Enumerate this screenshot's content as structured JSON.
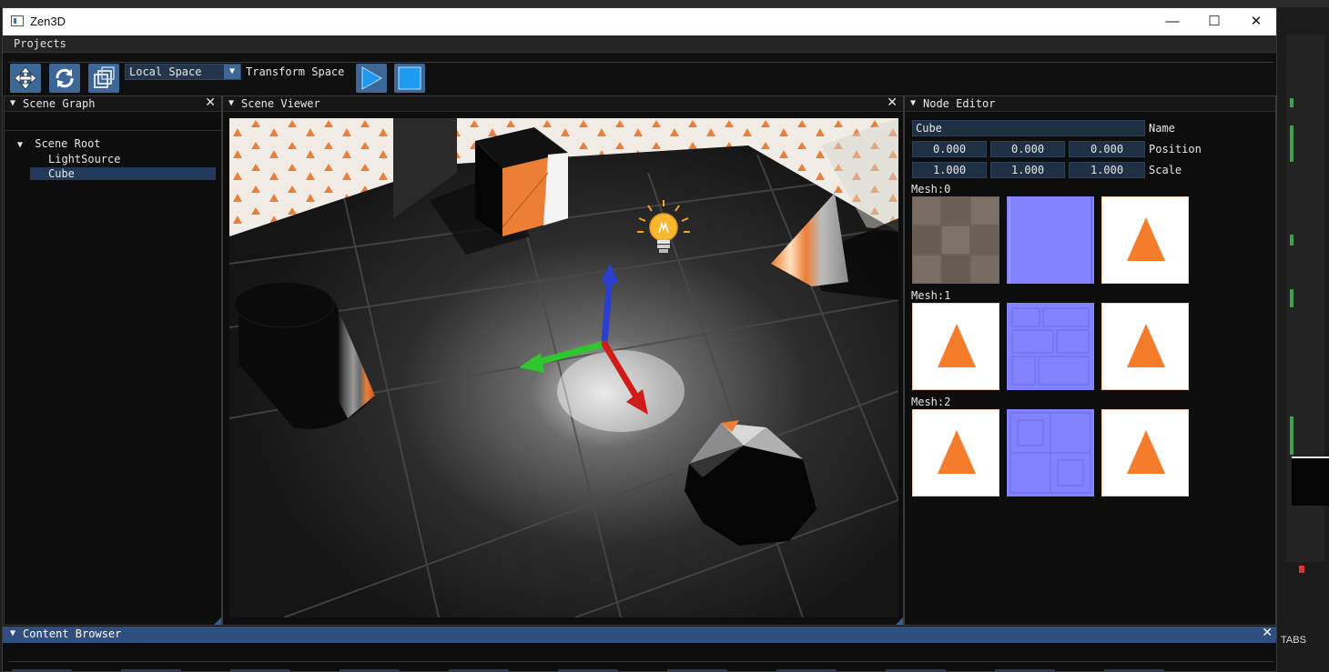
{
  "window": {
    "title": "Zen3D",
    "minimize_icon": "minimize-icon",
    "maximize_icon": "maximize-icon",
    "close_icon": "close-icon"
  },
  "menu": {
    "items": [
      "Projects"
    ]
  },
  "toolbar": {
    "buttons": [
      "move-tool-icon",
      "rotate-tool-icon",
      "scale-tool-icon"
    ],
    "space_select": {
      "value": "Local Space",
      "arrow": "▼"
    },
    "space_label": "Transform Space",
    "play_icon": "play-icon",
    "stop_icon": "stop-icon",
    "accent_color": "#3c6797"
  },
  "scene_graph": {
    "title": "Scene Graph",
    "collapse_glyph": "▼",
    "close_glyph": "✕",
    "root": {
      "label": "Scene Root",
      "glyph": "▼"
    },
    "children": [
      {
        "label": "LightSource",
        "selected": false
      },
      {
        "label": "Cube",
        "selected": true
      }
    ]
  },
  "scene_viewer": {
    "title": "Scene Viewer",
    "collapse_glyph": "▼",
    "close_glyph": "✕",
    "objects": [
      "wall-panels",
      "cube",
      "light-bulb-icon",
      "cone",
      "cylinder",
      "sphere",
      "transform-gizmo"
    ]
  },
  "node_editor": {
    "title": "Node Editor",
    "collapse_glyph": "▼",
    "name_value": "Cube",
    "name_label": "Name",
    "position": [
      "0.000",
      "0.000",
      "0.000"
    ],
    "position_label": "Position",
    "scale": [
      "1.000",
      "1.000",
      "1.000"
    ],
    "scale_label": "Scale",
    "meshes": [
      {
        "label": "Mesh:0",
        "textures": [
          "stone",
          "normal",
          "triangle"
        ]
      },
      {
        "label": "Mesh:1",
        "textures": [
          "triangle",
          "normal",
          "triangle"
        ]
      },
      {
        "label": "Mesh:2",
        "textures": [
          "triangle",
          "normal",
          "triangle"
        ]
      }
    ]
  },
  "content_browser": {
    "title": "Content Browser",
    "collapse_glyph": "▼",
    "close_glyph": "✕"
  },
  "background_app": {
    "tabs_label": "TABS"
  }
}
